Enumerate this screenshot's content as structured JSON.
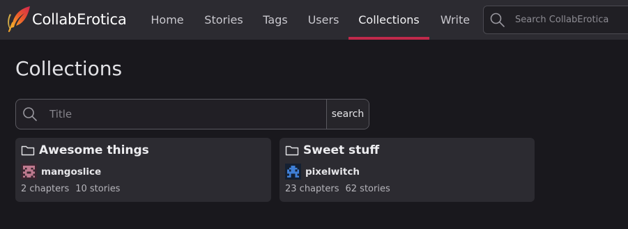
{
  "brand": {
    "name": "CollabErotica",
    "accent": "#c0294b"
  },
  "nav": {
    "items": [
      {
        "label": "Home"
      },
      {
        "label": "Stories"
      },
      {
        "label": "Tags"
      },
      {
        "label": "Users"
      },
      {
        "label": "Collections",
        "active": true
      },
      {
        "label": "Write"
      }
    ],
    "search_placeholder": "Search CollabErotica",
    "search_icon": "search-icon"
  },
  "page": {
    "title": "Collections",
    "filter": {
      "placeholder": "Title",
      "button_label": "search",
      "icon": "search-icon"
    }
  },
  "collections": [
    {
      "title": "Awesome things",
      "icon": "folder-icon",
      "user": "mangoslice",
      "avatar": "pixel-avatar",
      "chapters": "2 chapters",
      "stories": "10 stories"
    },
    {
      "title": "Sweet stuff",
      "icon": "folder-icon",
      "user": "pixelwitch",
      "avatar": "pixel-avatar",
      "chapters": "23 chapters",
      "stories": "62 stories"
    }
  ]
}
